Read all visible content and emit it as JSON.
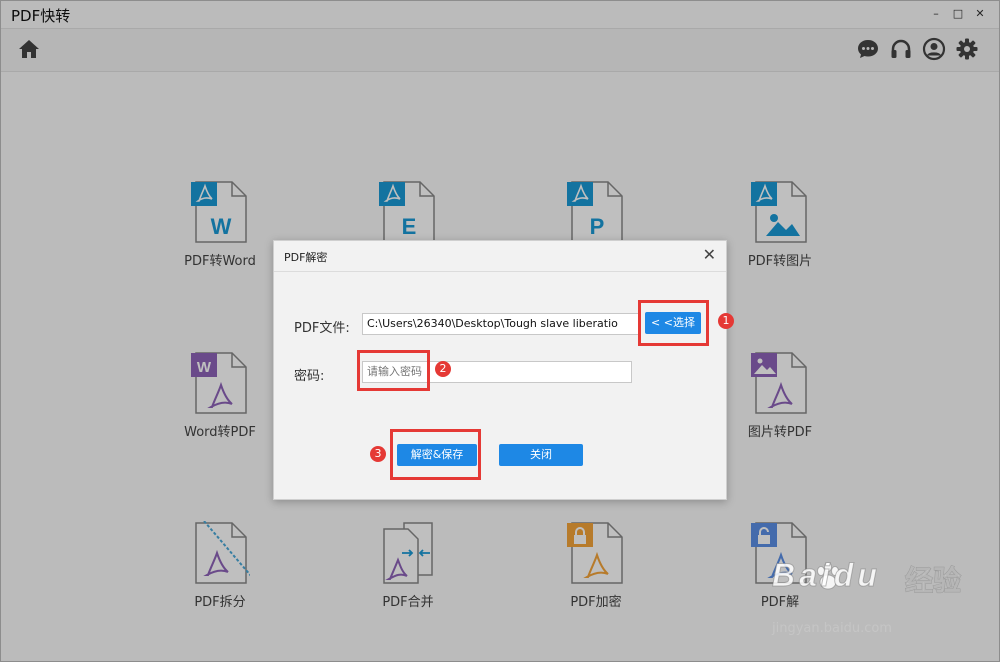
{
  "app": {
    "title": "PDF快转",
    "controls": [
      "–",
      "□",
      "✕"
    ]
  },
  "toolbar": {
    "home": "home-icon",
    "right": [
      "chat-icon",
      "headset-icon",
      "user-icon",
      "gear-icon"
    ]
  },
  "tools": [
    {
      "label": "PDF转Word",
      "letter": "W"
    },
    {
      "label": "",
      "letter": "E"
    },
    {
      "label": "",
      "letter": "P"
    },
    {
      "label": "PDF转图片",
      "letter": ""
    },
    {
      "label": "Word转PDF",
      "letter": "W"
    },
    {
      "label": "图片转PDF",
      "letter": ""
    },
    {
      "label": "PDF拆分",
      "letter": ""
    },
    {
      "label": "PDF合并",
      "letter": ""
    },
    {
      "label": "PDF加密",
      "letter": ""
    },
    {
      "label": "PDF解",
      "letter": ""
    }
  ],
  "dialog": {
    "title": "PDF解密",
    "close": "✕",
    "file_label": "PDF文件:",
    "file_value": "C:\\Users\\26340\\Desktop\\Tough slave liberatio",
    "choose_btn": "< <选择",
    "pwd_label": "密码:",
    "pwd_placeholder": "请输入密码",
    "decrypt_btn": "解密&保存",
    "close_btn": "关闭"
  },
  "annotations": {
    "badges": [
      "1",
      "2",
      "3"
    ],
    "color": "#e53935"
  },
  "colors": {
    "accent": "#1e88e5",
    "pdf_blue": "#1a9ad6",
    "word_purple": "#8e63b8",
    "lock_orange": "#f5a43a",
    "unlock_blue": "#5b8fe6"
  },
  "watermark": {
    "brand": "Baidu",
    "cn": "经验",
    "url": "jingyan.baidu.com"
  }
}
